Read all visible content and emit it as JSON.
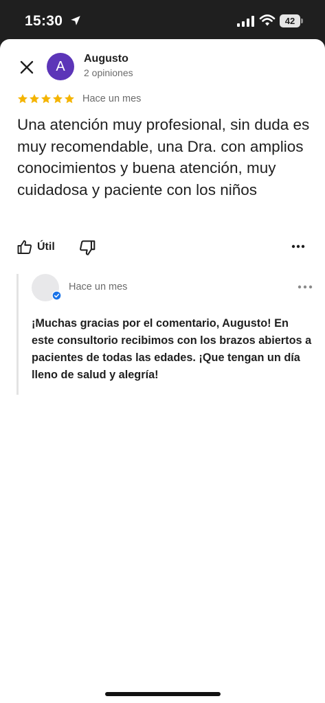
{
  "status_bar": {
    "time": "15:30",
    "battery": "42",
    "icons": [
      "location-arrow-icon",
      "cellular-signal-icon",
      "wifi-icon",
      "battery-icon"
    ]
  },
  "review": {
    "author_initial": "A",
    "author_name": "Augusto",
    "author_reviews": "2 opiniones",
    "rating": 5,
    "rating_max": 5,
    "date": "Hace un mes",
    "text": "Una atención muy profesional, sin duda es muy recomendable, una Dra. con amplios conocimientos y buena atención, muy cuidadosa y paciente con los niños",
    "useful_label": "Útil"
  },
  "reply": {
    "date": "Hace un mes",
    "text": "¡Muchas gracias por el comentario, Augusto! En este consultorio recibimos con los brazos abiertos a pacientes de todas las edades. ¡Que tengan un día lleno de salud y alegría!"
  },
  "colors": {
    "avatar": "#5c35b8",
    "star": "#f4b400",
    "verified": "#1a73e8",
    "text": "#1f1f1f",
    "secondary_text": "#6b6b6b"
  }
}
